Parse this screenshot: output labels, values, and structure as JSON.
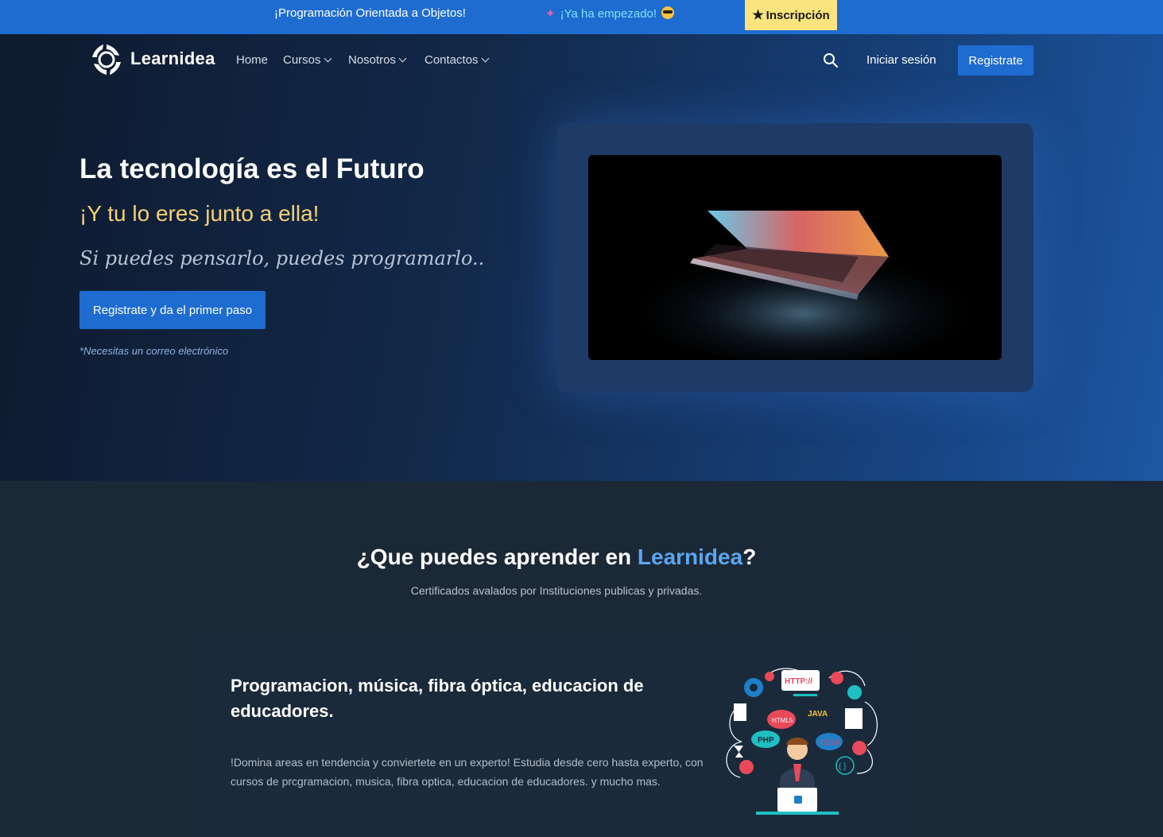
{
  "announcement": {
    "course": "¡Programación Orientada a Objetos!",
    "started": "¡Ya ha empezado!",
    "party_icon": "party-popper-icon",
    "cool_icon": "sunglasses-face-icon",
    "button_label": "Inscripción",
    "button_icon": "star-icon",
    "bar_color": "#1e6cd0",
    "button_color": "#fbe37d"
  },
  "nav": {
    "brand": "Learnidea",
    "items": [
      {
        "label": "Home"
      },
      {
        "label": "Cursos"
      },
      {
        "label": "Nosotros"
      },
      {
        "label": "Contactos"
      }
    ],
    "login": "Iniciar sesión",
    "register": "Registrate"
  },
  "hero": {
    "title": "La tecnología es el Futuro",
    "subtitle": "¡Y tu lo eres junto a ella!",
    "script": "Si puedes pensarlo, puedes programarlo..",
    "cta": "Registrate y da el primer paso",
    "note": "*Necesitas un correo electrónico",
    "accent_color": "#f5cf78"
  },
  "section": {
    "title_prefix": "¿Que puedes aprender en ",
    "title_highlight": "Learnidea",
    "title_suffix": "?",
    "subtitle": "Certificados avalados por Instituciones publicas y privadas.",
    "card": {
      "title": "Programacion, música, fibra óptica, educacion de educadores.",
      "text": "!Domina areas en tendencia y conviertete en un experto! Estudia desde cero hasta experto, con cursos de prcgramacion, musica, fibra optica, educacion de educadores. y mucho mas.",
      "illustration_labels": [
        "HTTP://",
        "JAVA",
        "HTML5",
        "PHP",
        "CSS3",
        "{ }"
      ]
    }
  }
}
